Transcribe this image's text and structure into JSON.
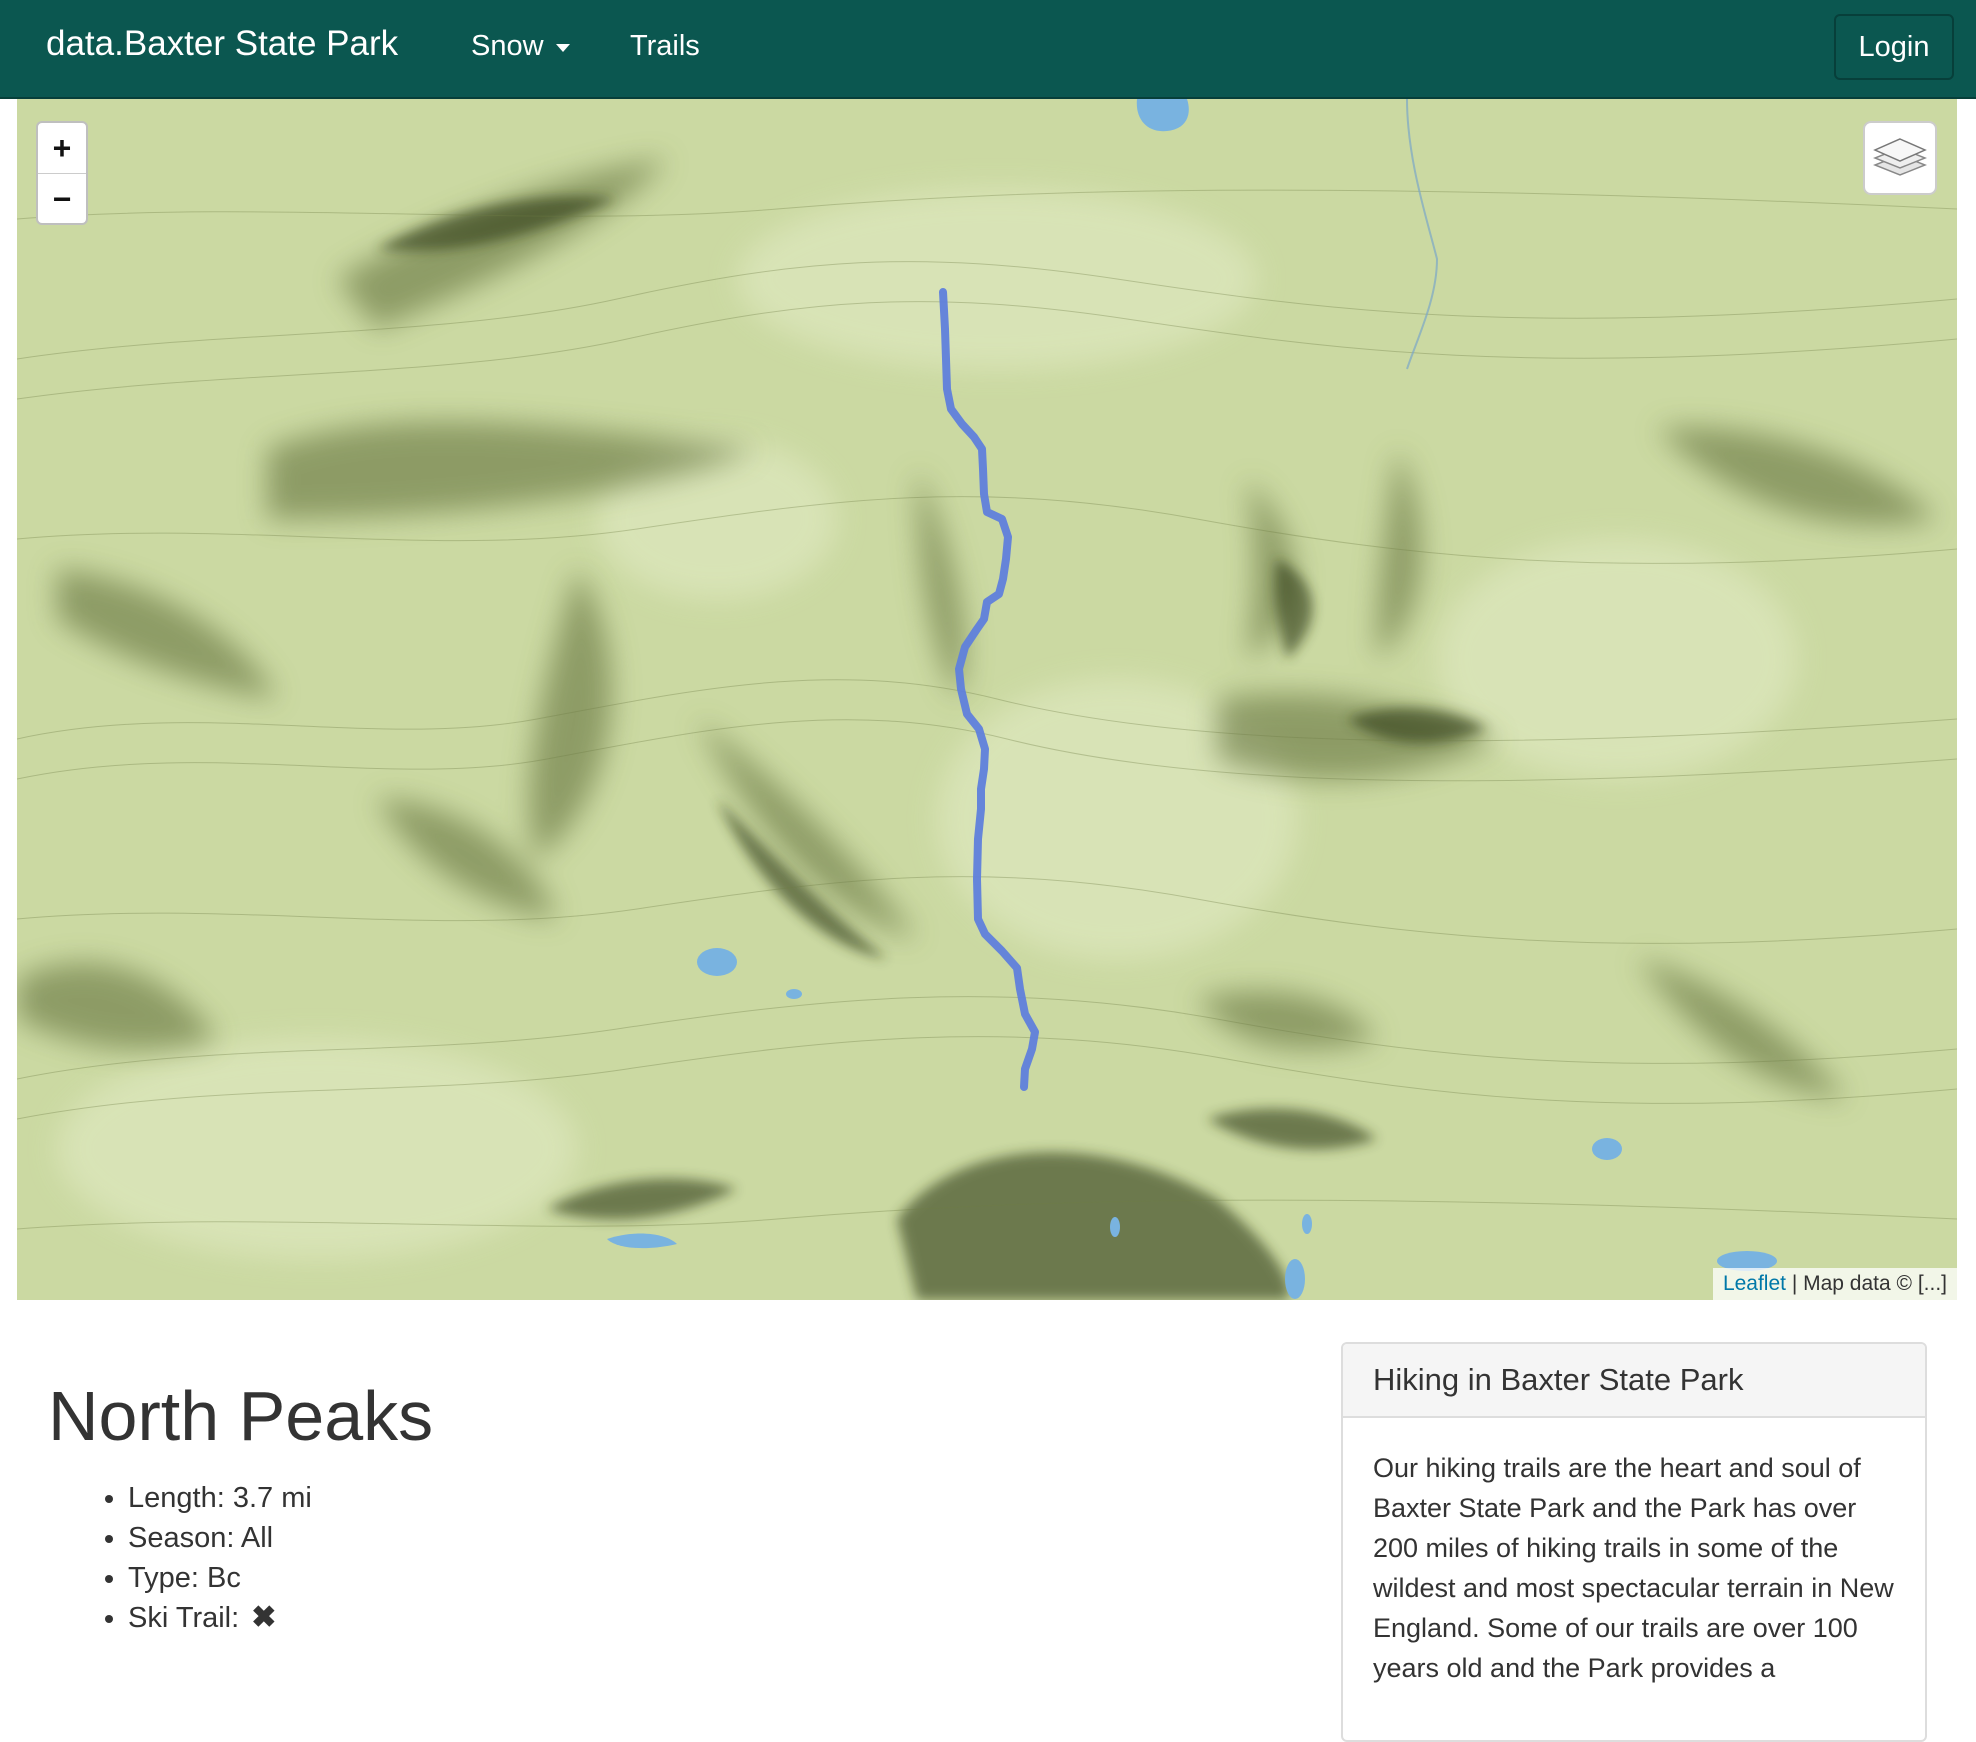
{
  "navbar": {
    "brand": "data.Baxter State Park",
    "items": [
      {
        "label": "Snow",
        "has_dropdown": true
      },
      {
        "label": "Trails",
        "has_dropdown": false
      }
    ],
    "login_label": "Login",
    "background_color": "#0b5750"
  },
  "map": {
    "zoom_in_label": "+",
    "zoom_out_label": "−",
    "layers_icon": "layers-icon",
    "attribution": {
      "leaflet_link": "Leaflet",
      "text": " | Map data © [...]"
    },
    "trail_color": "#5f7fdc",
    "terrain_color": "#cbd9a2",
    "water_color": "#79b3e0"
  },
  "trail": {
    "name": "North Peaks",
    "details": [
      {
        "label": "Length:",
        "value": "3.7 mi"
      },
      {
        "label": "Season:",
        "value": "All"
      },
      {
        "label": "Type:",
        "value": "Bc"
      },
      {
        "label": "Ski Trail:",
        "value": "✖"
      }
    ]
  },
  "sidebar_panel": {
    "title": "Hiking in Baxter State Park",
    "body": "Our hiking trails are the heart and soul of Baxter State Park and the Park has over 200 miles of hiking trails in some of the wildest and most spectacular terrain in New England. Some of our trails are over 100 years old and the Park provides a"
  }
}
